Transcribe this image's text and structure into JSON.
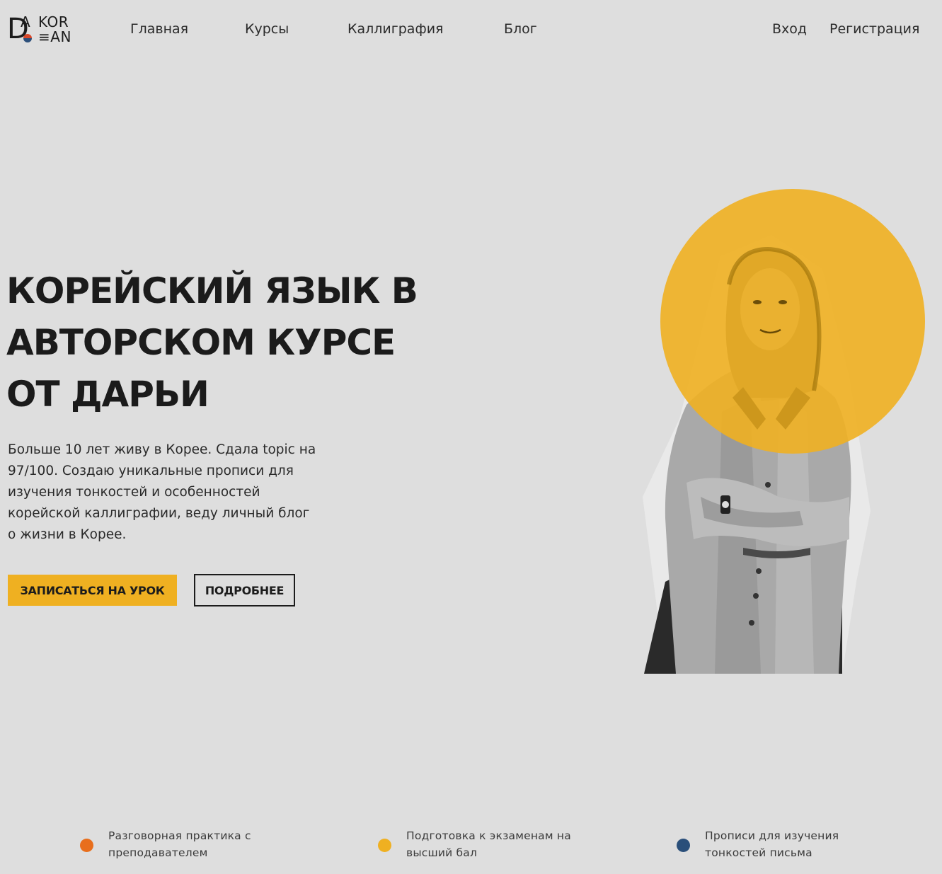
{
  "logo": {
    "letter_d": "D",
    "letter_a": "A",
    "line1": "KOR",
    "line2": "≡AN",
    "colors": {
      "dot_red": "#d9482a",
      "dot_blue": "#2c4f7a"
    }
  },
  "nav": {
    "items": [
      "Главная",
      "Курсы",
      "Каллиграфия",
      "Блог"
    ],
    "login": "Вход",
    "register": "Регистрация"
  },
  "hero": {
    "title_lines": [
      "Корейский язык в",
      "авторском курсе",
      "от Дарьи"
    ],
    "description": "Больше 10 лет живу в Корее. Сдала topic на 97/100. Создаю уникальные прописи для изучения тонкостей и особенностей корейской каллиграфии, веду личный блог о жизни в Корее.",
    "primary_button": "Записаться на урок",
    "secondary_button": "Подробнее",
    "accent_color": "#efb021"
  },
  "features": [
    {
      "text": "Разговорная практика с преподавателем",
      "color": "#e86e1c"
    },
    {
      "text": "Подготовка к экзаменам на высший бал",
      "color": "#efb021"
    },
    {
      "text": "Прописи для изучения тонкостей письма",
      "color": "#2a4f7a"
    }
  ]
}
